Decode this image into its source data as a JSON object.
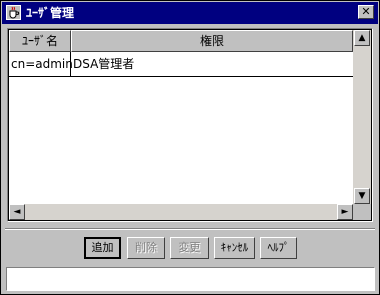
{
  "window": {
    "title": "ﾕｰｻﾞ管理",
    "close_label": "✕"
  },
  "table": {
    "columns": [
      "ﾕｰｻﾞ名",
      "権限"
    ],
    "rows": [
      {
        "user": "cn=admin",
        "permission": "DSA管理者"
      }
    ]
  },
  "scrollbars": {
    "up": "▲",
    "down": "▼",
    "left": "◄",
    "right": "►"
  },
  "buttons": {
    "add": "追加",
    "delete": "削除",
    "change": "変更",
    "cancel": "ｷｬﾝｾﾙ",
    "help": "ﾍﾙﾌﾟ"
  },
  "status": {
    "text": ""
  }
}
